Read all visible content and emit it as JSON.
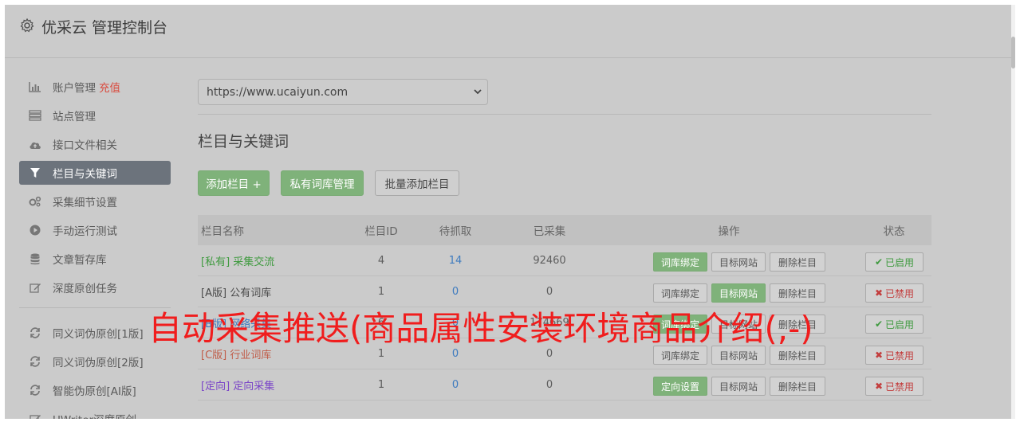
{
  "header": {
    "title": "优采云 管理控制台",
    "icon": "gear-icon"
  },
  "sidebar": {
    "items": [
      {
        "label": "账户管理",
        "badge": "充值",
        "icon": "bar-chart-icon"
      },
      {
        "label": "站点管理",
        "icon": "server-icon"
      },
      {
        "label": "接口文件相关",
        "icon": "cloud-upload-icon"
      },
      {
        "label": "栏目与关键词",
        "icon": "filter-icon",
        "active": true
      },
      {
        "label": "采集细节设置",
        "icon": "gears-icon"
      },
      {
        "label": "手动运行测试",
        "icon": "play-circle-icon"
      },
      {
        "label": "文章暂存库",
        "icon": "database-icon"
      },
      {
        "label": "深度原创任务",
        "icon": "edit-icon"
      }
    ],
    "items2": [
      {
        "label": "同义词伪原创[1版]",
        "icon": "refresh-icon"
      },
      {
        "label": "同义词伪原创[2版]",
        "icon": "refresh-icon"
      },
      {
        "label": "智能伪原创[AI版]",
        "icon": "refresh-icon"
      },
      {
        "label": "UWriter深度原创",
        "icon": "edit-icon"
      }
    ]
  },
  "main": {
    "site_select": "https://www.ucaiyun.com",
    "section_title": "栏目与关键词",
    "buttons": {
      "add": "添加栏目 +",
      "private": "私有词库管理",
      "batch": "批量添加栏目"
    }
  },
  "table": {
    "headers": {
      "name": "栏目名称",
      "id": "栏目ID",
      "pending": "待抓取",
      "collected": "已采集",
      "ops": "操作",
      "status": "状态"
    },
    "rows": [
      {
        "tag": "[私有]",
        "name": "采集交流",
        "id": "4",
        "pending": "14",
        "collected": "92460",
        "op1": "词库绑定",
        "op2": "目标网站",
        "op3": "删除栏目",
        "status": "已启用"
      },
      {
        "tag": "[A版]",
        "name": "公有词库",
        "id": "1",
        "pending": "0",
        "collected": "0",
        "op1": "词库绑定",
        "op2": "目标网站",
        "op3": "删除栏目",
        "status": "已禁用"
      },
      {
        "tag": "[B版]",
        "name": "网络采集",
        "id": "6",
        "pending": "0",
        "collected": "174669",
        "op1": "词库绑定",
        "op2": "目标网站",
        "op3": "删除栏目",
        "status": "已启用"
      },
      {
        "tag": "[C版]",
        "name": "行业词库",
        "id": "1",
        "pending": "0",
        "collected": "0",
        "op1": "词库绑定",
        "op2": "目标网站",
        "op3": "删除栏目",
        "status": "已禁用"
      },
      {
        "tag": "[定向]",
        "name": "定向采集",
        "id": "1",
        "pending": "0",
        "collected": "0",
        "op1": "定向设置",
        "op2": "目标网站",
        "op3": "删除栏目",
        "status": "已禁用"
      }
    ]
  },
  "overlay_text": "自动采集推送(商品属性安装环境商品介绍(,-)",
  "colors": {
    "green": "#7fb27a",
    "active_nav": "#6c737c",
    "overlay": "#f01d1d",
    "enabled": "#3f9a3f",
    "disabled": "#c33d3d"
  }
}
